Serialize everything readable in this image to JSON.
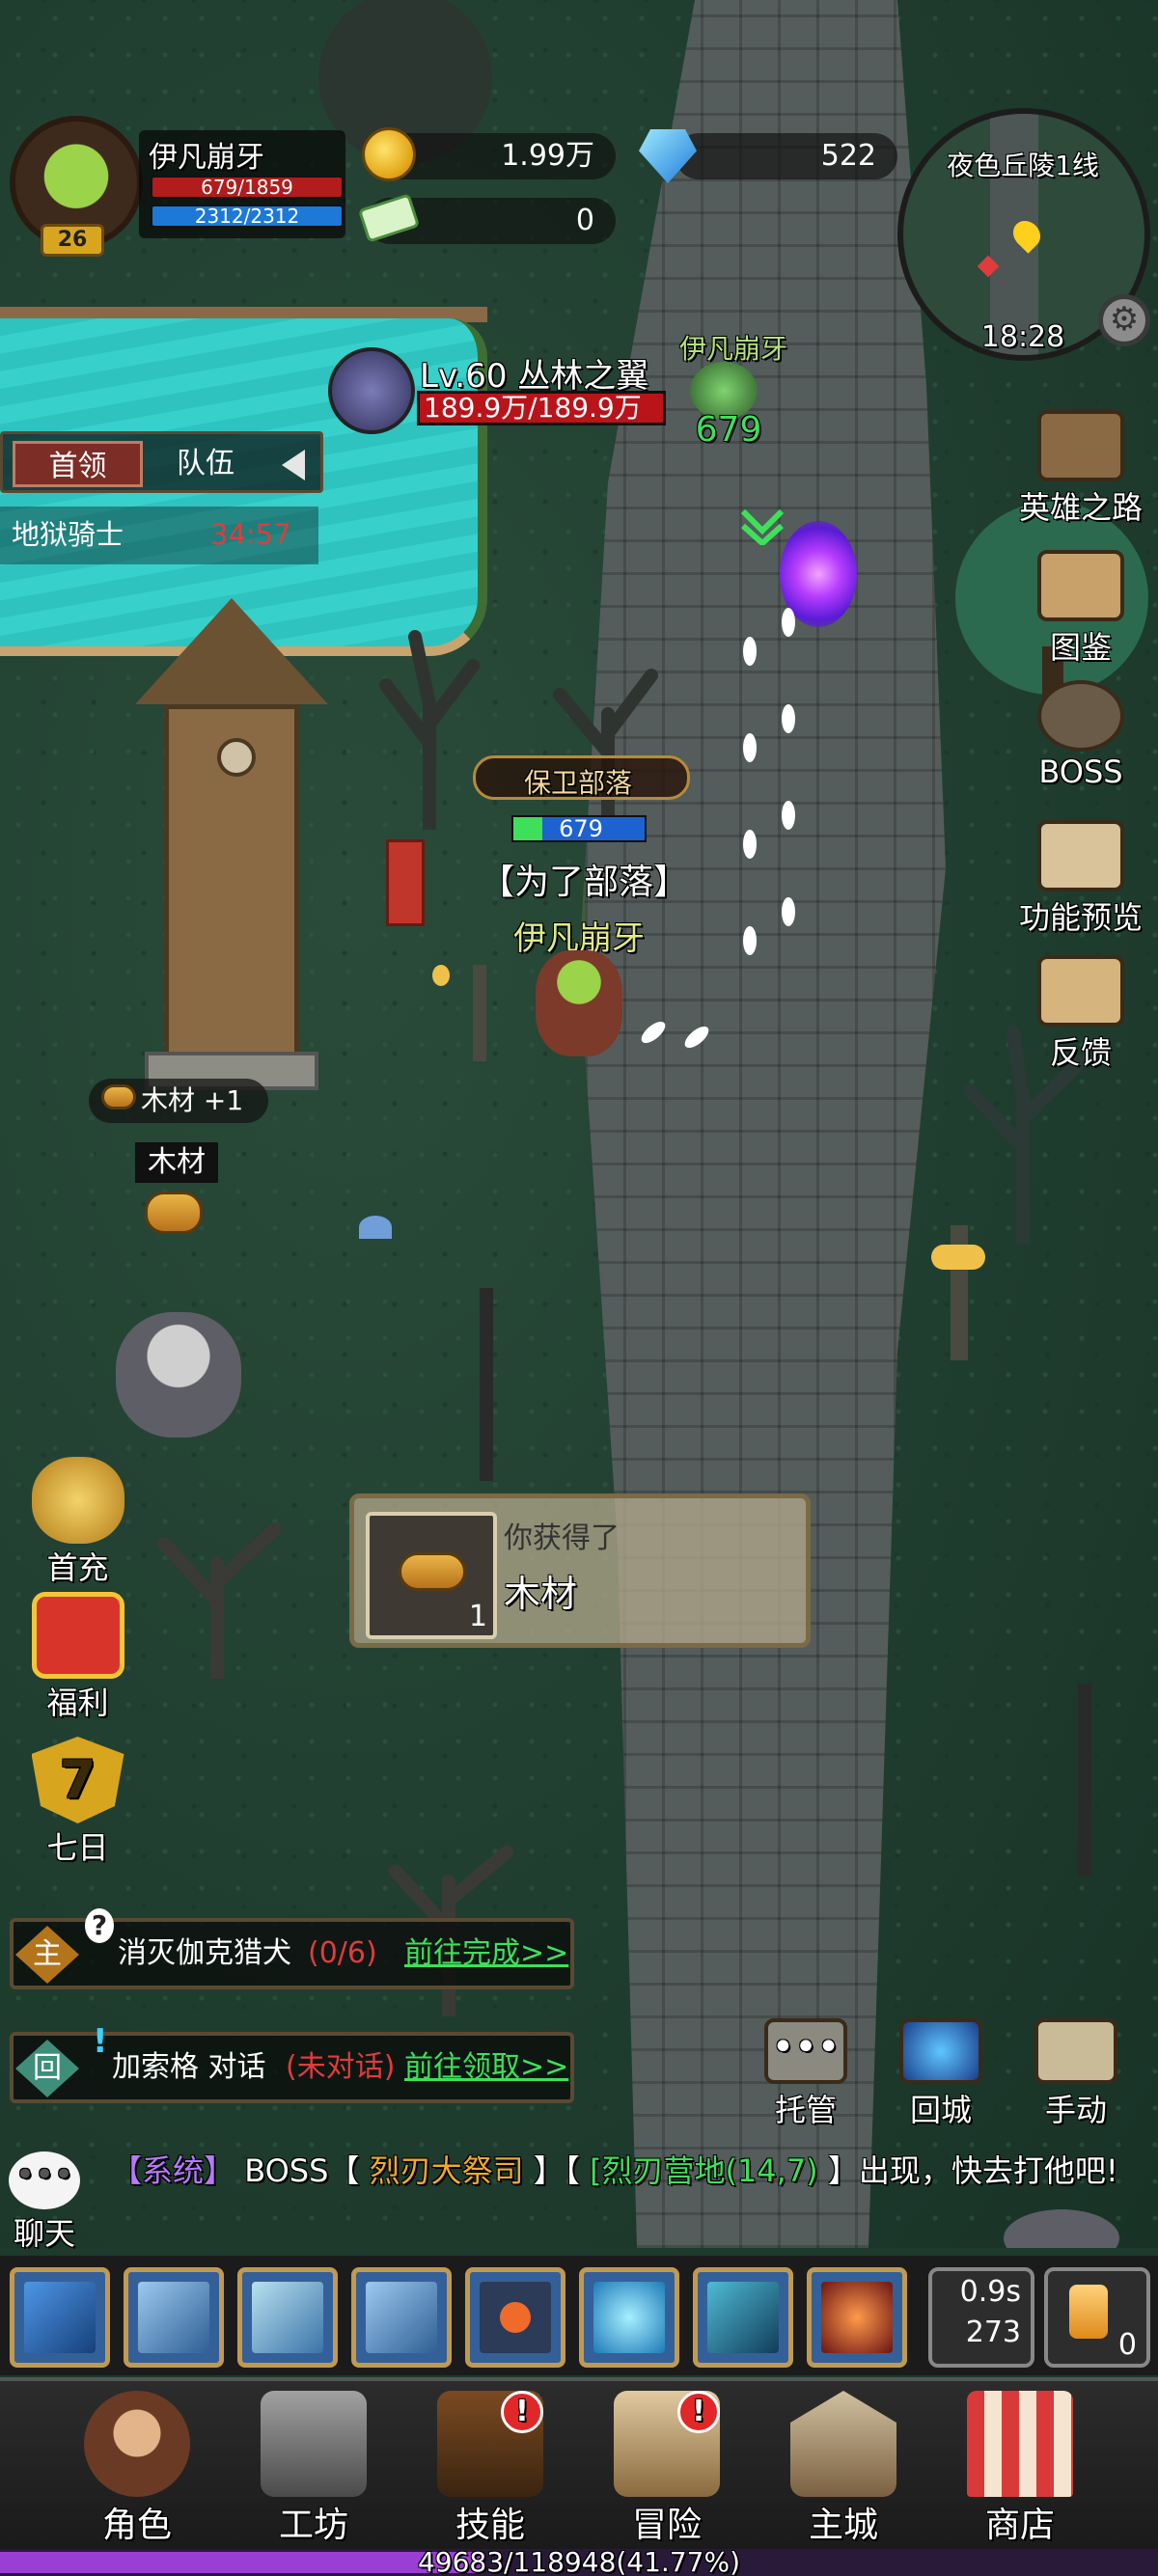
{
  "player": {
    "name": "伊凡崩牙",
    "level": "26",
    "hp": "679/1859",
    "mp": "2312/2312"
  },
  "resources": {
    "gold": "1.99万",
    "gems": "522",
    "tickets": "0"
  },
  "minimap": {
    "zone": "夜色丘陵1线",
    "time": "18:28"
  },
  "boss_target": {
    "label": "Lv.60 丛林之翼",
    "hp": "189.9万/189.9万"
  },
  "tabs": [
    "首领",
    "队伍"
  ],
  "hell_knight": {
    "name": "地狱骑士",
    "timer": "34:57"
  },
  "ally": {
    "name": "伊凡崩牙",
    "value": "679"
  },
  "world": {
    "guild_badge": "保卫部落",
    "player_hp": "679",
    "guild_tag": "【为了部落】",
    "player_name": "伊凡崩牙",
    "wood_gain": "木材 +1",
    "wood_label": "木材"
  },
  "right_menu": [
    "英雄之路",
    "图鉴",
    "BOSS",
    "功能预览",
    "反馈"
  ],
  "left_menu": [
    "首充",
    "福利",
    "七日"
  ],
  "seven_day_num": "7",
  "toast": {
    "title": "你获得了",
    "item": "木材",
    "count": "1"
  },
  "quests": [
    {
      "tag": "主",
      "text": "消灭伽克猎犬",
      "progress": "(0/6)",
      "action": "前往完成>>"
    },
    {
      "tag": "回",
      "text": "加索格 对话",
      "progress": "(未对话)",
      "action": "前往领取>>"
    }
  ],
  "action_buttons": [
    "托管",
    "回城",
    "手动"
  ],
  "chat": {
    "label": "聊天",
    "channel": "【系统】",
    "pre": "BOSS【",
    "boss": "烈刃大祭司",
    "mid": "】【",
    "loc": "[烈刃营地(14,7)",
    "post": "】出现，快去打他吧!"
  },
  "skill_cd": {
    "time": "0.9s",
    "count": "273"
  },
  "potion_count": "0",
  "nav": [
    "角色",
    "工坊",
    "技能",
    "冒险",
    "主城",
    "商店"
  ],
  "nav_alert": "!",
  "exp": {
    "text": "49683/118948(41.77%)",
    "fraction": 0.4177
  },
  "colors": {
    "accent_gold": "#e0a313",
    "quest_green": "#3ee05a",
    "progress_red": "#e23b3b",
    "boss_hp_red": "#b9141a",
    "exp_purple": "#9a3fd3"
  }
}
